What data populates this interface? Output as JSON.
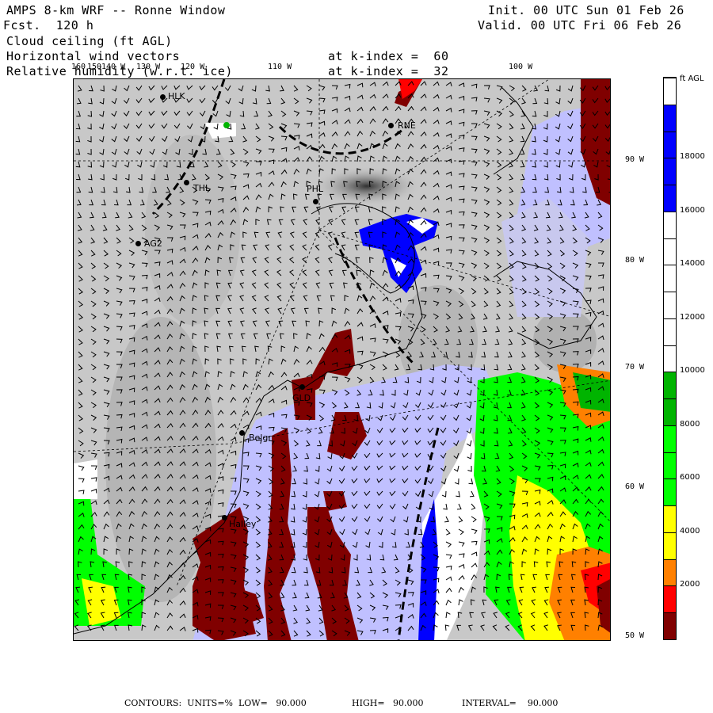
{
  "header": {
    "title": "AMPS 8-km WRF -- Ronne Window",
    "forecast": "Fcst.  120 h",
    "init": "Init. 00 UTC Sun 01 Feb 26",
    "valid": "Valid. 00 UTC Fri 06 Feb 26",
    "field1": "Cloud ceiling (ft AGL)",
    "field2": "Horizontal wind vectors",
    "field3": "Relative humidity (w.r.t. ice)",
    "kindex1": "at k-index =  60",
    "kindex2": "at k-index =  32"
  },
  "map": {
    "top_lon_labels": [
      "160",
      "150",
      "140 W",
      "130 W",
      "120 W",
      "110 W",
      "100 W"
    ],
    "right_lon_labels": [
      "90 W",
      "80 W",
      "70 W",
      "60 W",
      "50 W"
    ],
    "stations": [
      {
        "label": "HLK"
      },
      {
        "label": "RNE"
      },
      {
        "label": "THL"
      },
      {
        "label": "PHL"
      },
      {
        "label": "AG2"
      },
      {
        "label": "GLD"
      },
      {
        "label": "Belgr"
      },
      {
        "label": "Halley"
      }
    ]
  },
  "colorbar": {
    "units": "ft AGL",
    "tick_labels": [
      "18000",
      "16000",
      "14000",
      "12000",
      "10000",
      "8000",
      "6000",
      "4000",
      "2000"
    ],
    "levels": [
      {
        "from": 0,
        "to": 1000,
        "color": "#800000"
      },
      {
        "from": 1000,
        "to": 2000,
        "color": "#ff0000"
      },
      {
        "from": 2000,
        "to": 3000,
        "color": "#ff8000"
      },
      {
        "from": 3000,
        "to": 5000,
        "color": "#ffff00"
      },
      {
        "from": 5000,
        "to": 8000,
        "color": "#00ff00"
      },
      {
        "from": 8000,
        "to": 10000,
        "color": "#00b400"
      },
      {
        "from": 10000,
        "to": 16000,
        "color": "#ffffff"
      },
      {
        "from": 16000,
        "to": 20000,
        "color": "#0000ff"
      },
      {
        "from": 20000,
        "to": 21000,
        "color": "#ffffff"
      }
    ]
  },
  "footer": {
    "contours": "CONTOURS:  UNITS=%  LOW=   90.000",
    "high": "HIGH=   90.000",
    "interval": "INTERVAL=    90.000"
  }
}
